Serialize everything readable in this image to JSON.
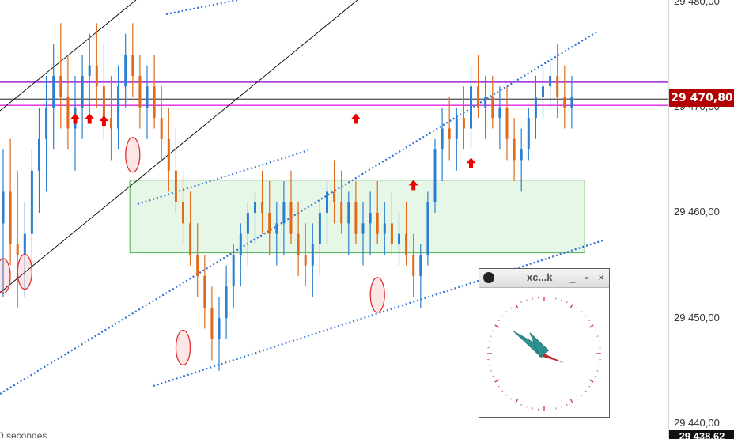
{
  "chart_data": {
    "type": "candlestick",
    "axis": {
      "y_ticks": [
        "29 480,00",
        "29 470,00",
        "29 460,00",
        "29 450,00",
        "29 440,00"
      ],
      "ylim": [
        29438.6,
        29480.2
      ]
    },
    "last_price": {
      "label": "29 470,80",
      "value": 29470.8
    },
    "low_price": {
      "label": "29 438,62",
      "value": 29438.62
    },
    "period_label": "0 secondes",
    "horizontal_levels": [
      {
        "value": 29472.4,
        "color": "#9c27d6"
      },
      {
        "value": 29470.8,
        "color": "#000000"
      },
      {
        "value": 29470.2,
        "color": "#e020e0"
      }
    ],
    "zone": {
      "y_from": 29456.2,
      "y_to": 29463.1,
      "x_from": 62,
      "x_to": 167,
      "color": "#4caf50"
    },
    "candles": [
      [
        29459,
        29466,
        29452,
        29462
      ],
      [
        29462,
        29467,
        29455,
        29457
      ],
      [
        29457,
        29464,
        29451,
        29456
      ],
      [
        29456,
        29461,
        29452,
        29458
      ],
      [
        29458,
        29466,
        29455,
        29464
      ],
      [
        29464,
        29470,
        29460,
        29467
      ],
      [
        29467,
        29473,
        29462,
        29470
      ],
      [
        29470,
        29476,
        29466,
        29473
      ],
      [
        29473,
        29478,
        29468,
        29471
      ],
      [
        29471,
        29475,
        29466,
        29468
      ],
      [
        29468,
        29473,
        29464,
        29470
      ],
      [
        29470,
        29475,
        29467,
        29473
      ],
      [
        29473,
        29477,
        29469,
        29474
      ],
      [
        29474,
        29478,
        29470,
        29472
      ],
      [
        29472,
        29476,
        29467,
        29469
      ],
      [
        29469,
        29473,
        29465,
        29468
      ],
      [
        29468,
        29474,
        29466,
        29472
      ],
      [
        29472,
        29477,
        29470,
        29475
      ],
      [
        29475,
        29478,
        29471,
        29473
      ],
      [
        29473,
        29475,
        29468,
        29470
      ],
      [
        29470,
        29474,
        29467,
        29472
      ],
      [
        29472,
        29475,
        29468,
        29469
      ],
      [
        29469,
        29472,
        29465,
        29467
      ],
      [
        29467,
        29470,
        29462,
        29464
      ],
      [
        29464,
        29468,
        29460,
        29461
      ],
      [
        29461,
        29464,
        29457,
        29459
      ],
      [
        29459,
        29462,
        29455,
        29456
      ],
      [
        29456,
        29459,
        29452,
        29454
      ],
      [
        29454,
        29456,
        29449,
        29451
      ],
      [
        29451,
        29453,
        29446,
        29448
      ],
      [
        29448,
        29452,
        29445,
        29450
      ],
      [
        29450,
        29455,
        29448,
        29453
      ],
      [
        29453,
        29457,
        29451,
        29456
      ],
      [
        29456,
        29459,
        29453,
        29458
      ],
      [
        29458,
        29461,
        29455,
        29460
      ],
      [
        29460,
        29462,
        29457,
        29461
      ],
      [
        29461,
        29464,
        29458,
        29460
      ],
      [
        29460,
        29463,
        29456,
        29458
      ],
      [
        29458,
        29461,
        29455,
        29459
      ],
      [
        29459,
        29463,
        29456,
        29461
      ],
      [
        29461,
        29464,
        29457,
        29458
      ],
      [
        29458,
        29461,
        29454,
        29456
      ],
      [
        29456,
        29459,
        29453,
        29455
      ],
      [
        29455,
        29459,
        29452,
        29457
      ],
      [
        29457,
        29461,
        29454,
        29460
      ],
      [
        29460,
        29463,
        29457,
        29462
      ],
      [
        29462,
        29465,
        29459,
        29461
      ],
      [
        29461,
        29464,
        29458,
        29459
      ],
      [
        29459,
        29462,
        29456,
        29461
      ],
      [
        29461,
        29463,
        29457,
        29458
      ],
      [
        29458,
        29461,
        29455,
        29459
      ],
      [
        29459,
        29462,
        29456,
        29460
      ],
      [
        29460,
        29463,
        29457,
        29458
      ],
      [
        29458,
        29461,
        29456,
        29459
      ],
      [
        29459,
        29462,
        29456,
        29457
      ],
      [
        29457,
        29460,
        29455,
        29458
      ],
      [
        29458,
        29461,
        29455,
        29456
      ],
      [
        29456,
        29458,
        29452,
        29454
      ],
      [
        29454,
        29457,
        29451,
        29456
      ],
      [
        29456,
        29462,
        29455,
        29461
      ],
      [
        29461,
        29467,
        29460,
        29466
      ],
      [
        29466,
        29470,
        29463,
        29468
      ],
      [
        29468,
        29471,
        29465,
        29467
      ],
      [
        29467,
        29470,
        29464,
        29469
      ],
      [
        29469,
        29472,
        29466,
        29468
      ],
      [
        29468,
        29474,
        29466,
        29472
      ],
      [
        29472,
        29475,
        29469,
        29470
      ],
      [
        29470,
        29473,
        29467,
        29471
      ],
      [
        29471,
        29473,
        29468,
        29469
      ],
      [
        29469,
        29472,
        29466,
        29470
      ],
      [
        29470,
        29472,
        29465,
        29467
      ],
      [
        29467,
        29469,
        29463,
        29465
      ],
      [
        29465,
        29468,
        29462,
        29466
      ],
      [
        29466,
        29470,
        29465,
        29469
      ],
      [
        29469,
        29473,
        29467,
        29471
      ],
      [
        29471,
        29474,
        29469,
        29472
      ],
      [
        29472,
        29475,
        29470,
        29473
      ],
      [
        29473,
        29476,
        29469,
        29471
      ],
      [
        29471,
        29474,
        29468,
        29470
      ],
      [
        29470,
        29473,
        29468,
        29471
      ]
    ],
    "arrows": [
      {
        "candle": 10,
        "value": 29468.9
      },
      {
        "candle": 12,
        "value": 29468.9
      },
      {
        "candle": 14,
        "value": 29468.7
      },
      {
        "candle": 49,
        "value": 29468.9
      },
      {
        "candle": 57,
        "value": 29462.6
      },
      {
        "candle": 65,
        "value": 29464.7
      }
    ],
    "circles": [
      {
        "candle": 0,
        "value": 29454.0
      },
      {
        "candle": 3,
        "value": 29454.4
      },
      {
        "candle": 18,
        "value": 29465.5
      },
      {
        "candle": 25,
        "value": 29447.2
      },
      {
        "candle": 52,
        "value": 29452.2
      }
    ]
  },
  "xclock": {
    "title": "xc...k",
    "minimize_glyph": "_",
    "maximize_glyph": "▫",
    "close_glyph": "×",
    "time_hour": 10,
    "time_minute": 51,
    "face_color": "#2e9090",
    "tick_color": "#d04050"
  }
}
